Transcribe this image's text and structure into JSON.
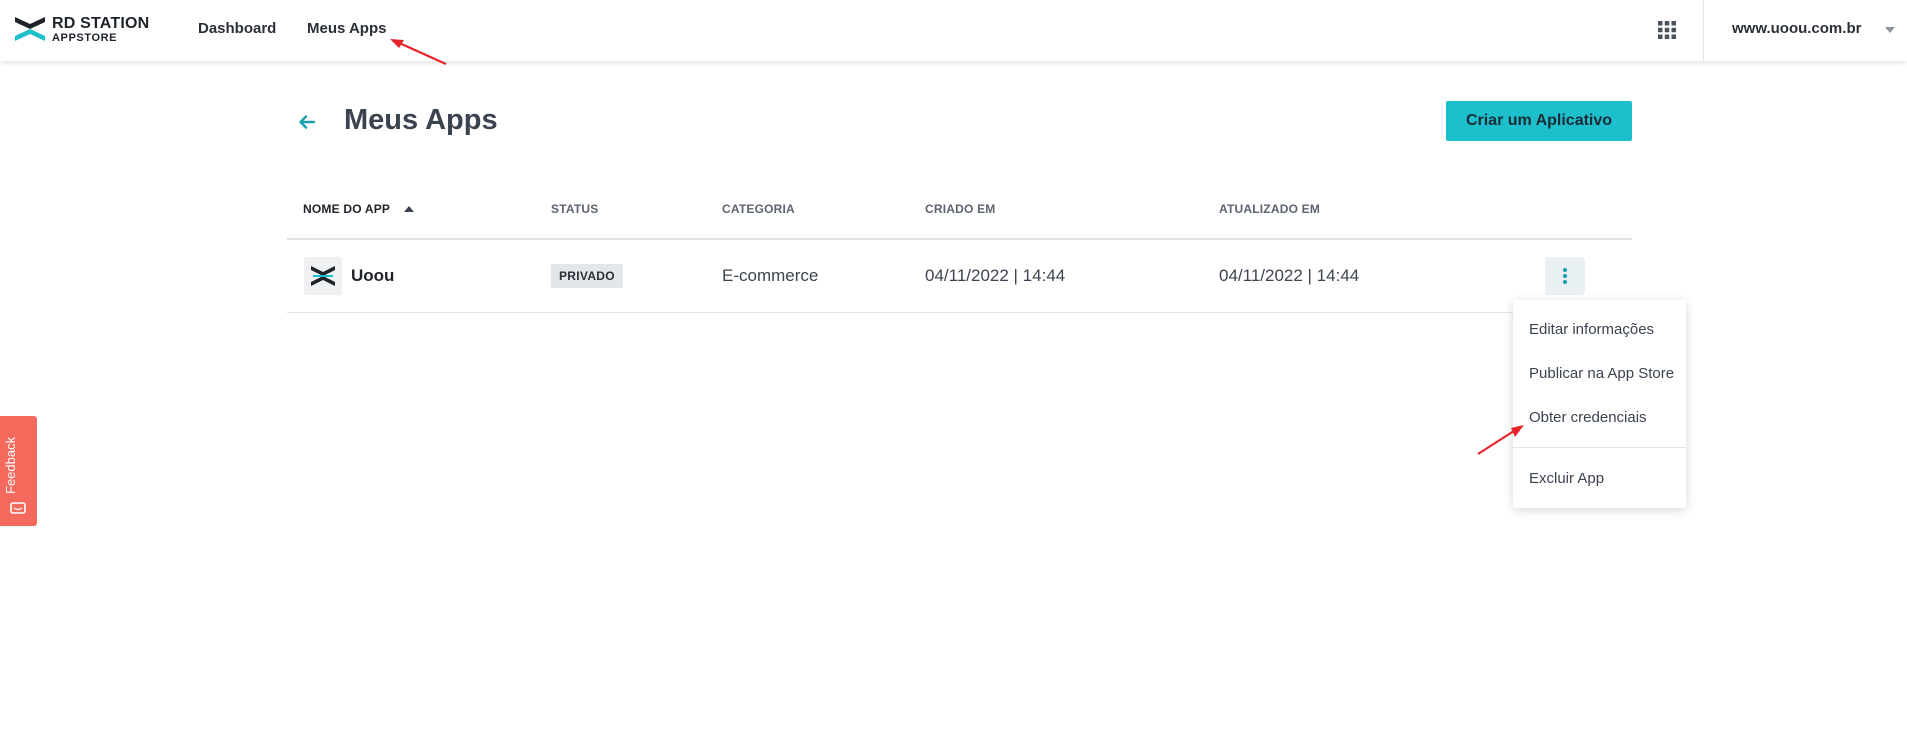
{
  "header": {
    "brand_line1": "RD STATION",
    "brand_line2": "APPSTORE",
    "nav": {
      "dashboard": "Dashboard",
      "meus_apps": "Meus Apps"
    },
    "apps_grid_icon": "grid-icon",
    "account": "www.uoou.com.br"
  },
  "page": {
    "title": "Meus Apps",
    "create_button": "Criar um Aplicativo"
  },
  "table": {
    "headers": [
      "NOME DO APP",
      "STATUS",
      "CATEGORIA",
      "CRIADO EM",
      "ATUALIZADO EM"
    ],
    "rows": [
      {
        "name": "Uoou",
        "status": "PRIVADO",
        "category": "E-commerce",
        "created": "04/11/2022 | 14:44",
        "updated": "04/11/2022 | 14:44"
      }
    ]
  },
  "menu": {
    "items": [
      "Editar informações",
      "Publicar na App Store",
      "Obter credenciais",
      "Excluir App"
    ]
  },
  "feedback": {
    "label": "Feedback"
  },
  "colors": {
    "accent": "#1ebfcc",
    "feedback": "#f36a5d",
    "annotation_arrow": "#e8232b"
  }
}
